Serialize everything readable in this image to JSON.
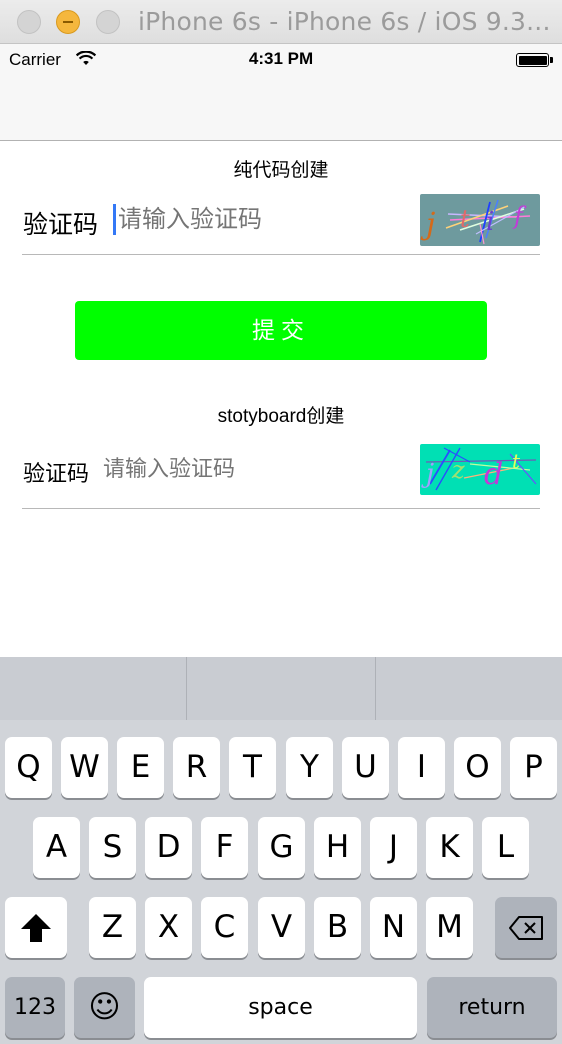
{
  "window": {
    "title": "iPhone 6s - iPhone 6s / iOS 9.3..."
  },
  "status_bar": {
    "carrier": "Carrier",
    "time": "4:31 PM"
  },
  "code_section": {
    "title": "纯代码创建",
    "label": "验证码",
    "placeholder": "请输入验证码",
    "captcha_chars": [
      "j",
      "t",
      "i",
      "f"
    ]
  },
  "submit_label": "提交",
  "storyboard_section": {
    "title": "stotyboard创建",
    "label": "验证码",
    "placeholder": "请输入验证码",
    "captcha_chars": [
      "j",
      "z",
      "d",
      "t"
    ]
  },
  "keyboard": {
    "row1": [
      "Q",
      "W",
      "E",
      "R",
      "T",
      "Y",
      "U",
      "I",
      "O",
      "P"
    ],
    "row2": [
      "A",
      "S",
      "D",
      "F",
      "G",
      "H",
      "J",
      "K",
      "L"
    ],
    "row3": [
      "Z",
      "X",
      "C",
      "V",
      "B",
      "N",
      "M"
    ],
    "numbers_label": "123",
    "space_label": "space",
    "return_label": "return",
    "emoji_glyph": "☺"
  },
  "colors": {
    "submit_bg": "#00ff00",
    "captcha1_bg": "#6e9a9e",
    "captcha2_bg": "#00e0b4",
    "caret": "#3478f6"
  }
}
